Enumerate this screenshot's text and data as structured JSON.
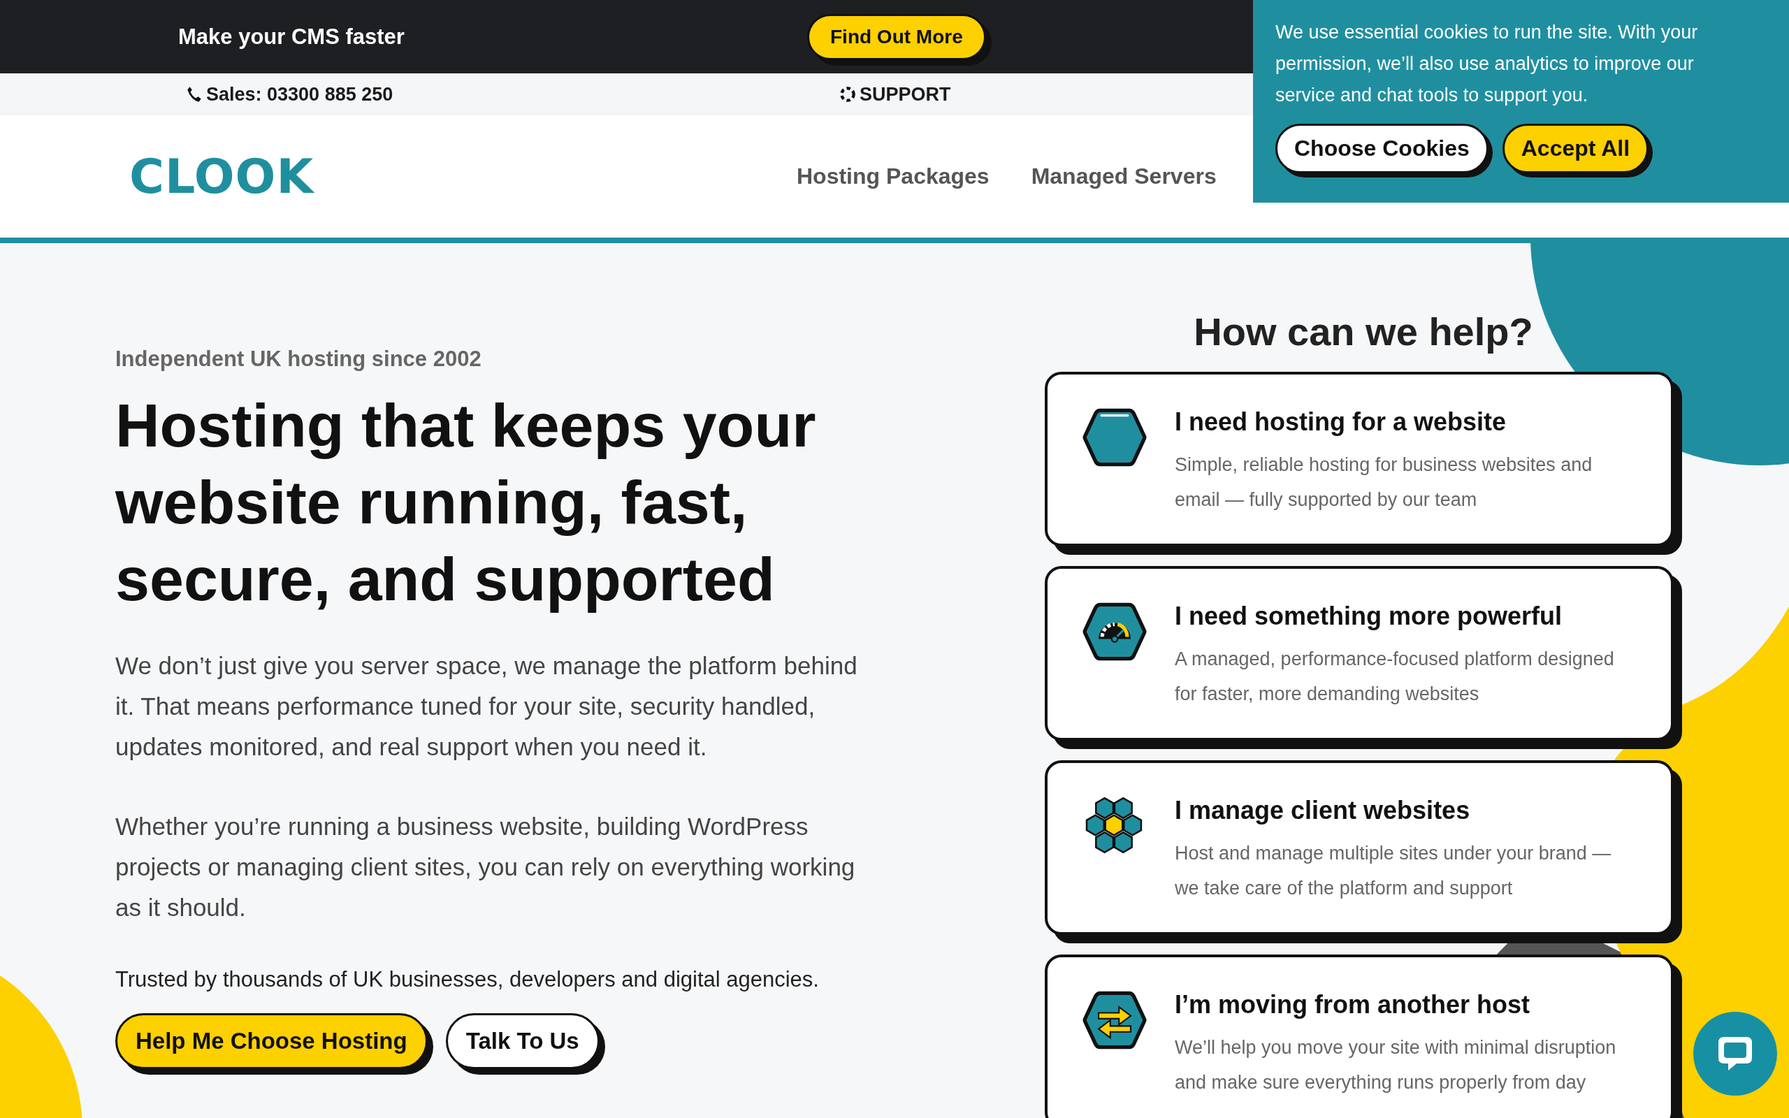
{
  "promo_bar": {
    "text": "Make your CMS faster",
    "button": "Find Out More"
  },
  "contact_bar": {
    "sales": "Sales: 03300 885 250",
    "support": "SUPPORT"
  },
  "header": {
    "logo": "CLOOK",
    "nav": [
      "Hosting Packages",
      "Managed Servers"
    ]
  },
  "cookie_banner": {
    "text": "We use essential cookies to run the site. With your permission, we’ll also use analytics to improve our service and chat tools to support you.",
    "buttons": [
      {
        "label": "Choose Cookies",
        "kind": "secondary"
      },
      {
        "label": "Accept All",
        "kind": "primary"
      }
    ]
  },
  "hero": {
    "eyebrow": "Independent UK hosting since 2002",
    "title": "Hosting that keeps your website running, fast, secure, and supported",
    "paragraphs": [
      "We don’t just give you server space, we manage the platform behind it. That means performance tuned for your site, security handled, updates monitored, and real support when you need it.",
      "Whether you’re running a business website, building WordPress projects or managing client sites, you can rely on everything working as it should."
    ],
    "trust": "Trusted by thousands of UK businesses, developers and digital agencies.",
    "buttons": [
      {
        "label": "Help Me Choose Hosting",
        "kind": "primary"
      },
      {
        "label": "Talk To Us",
        "kind": "secondary"
      }
    ]
  },
  "help": {
    "title": "How can we help?",
    "cards": [
      {
        "title": "I need hosting for a website",
        "text": "Simple, reliable hosting for business websites and email — fully supported by our team"
      },
      {
        "title": "I need something more powerful",
        "text": "A managed, performance-focused platform designed for faster, more demanding websites"
      },
      {
        "title": "I manage client websites",
        "text": "Host and manage multiple sites under your brand — we take care of the platform and support"
      },
      {
        "title": "I’m moving from another host",
        "text": "We’ll help you move your site with minimal disruption and make sure everything runs properly from day"
      }
    ]
  }
}
